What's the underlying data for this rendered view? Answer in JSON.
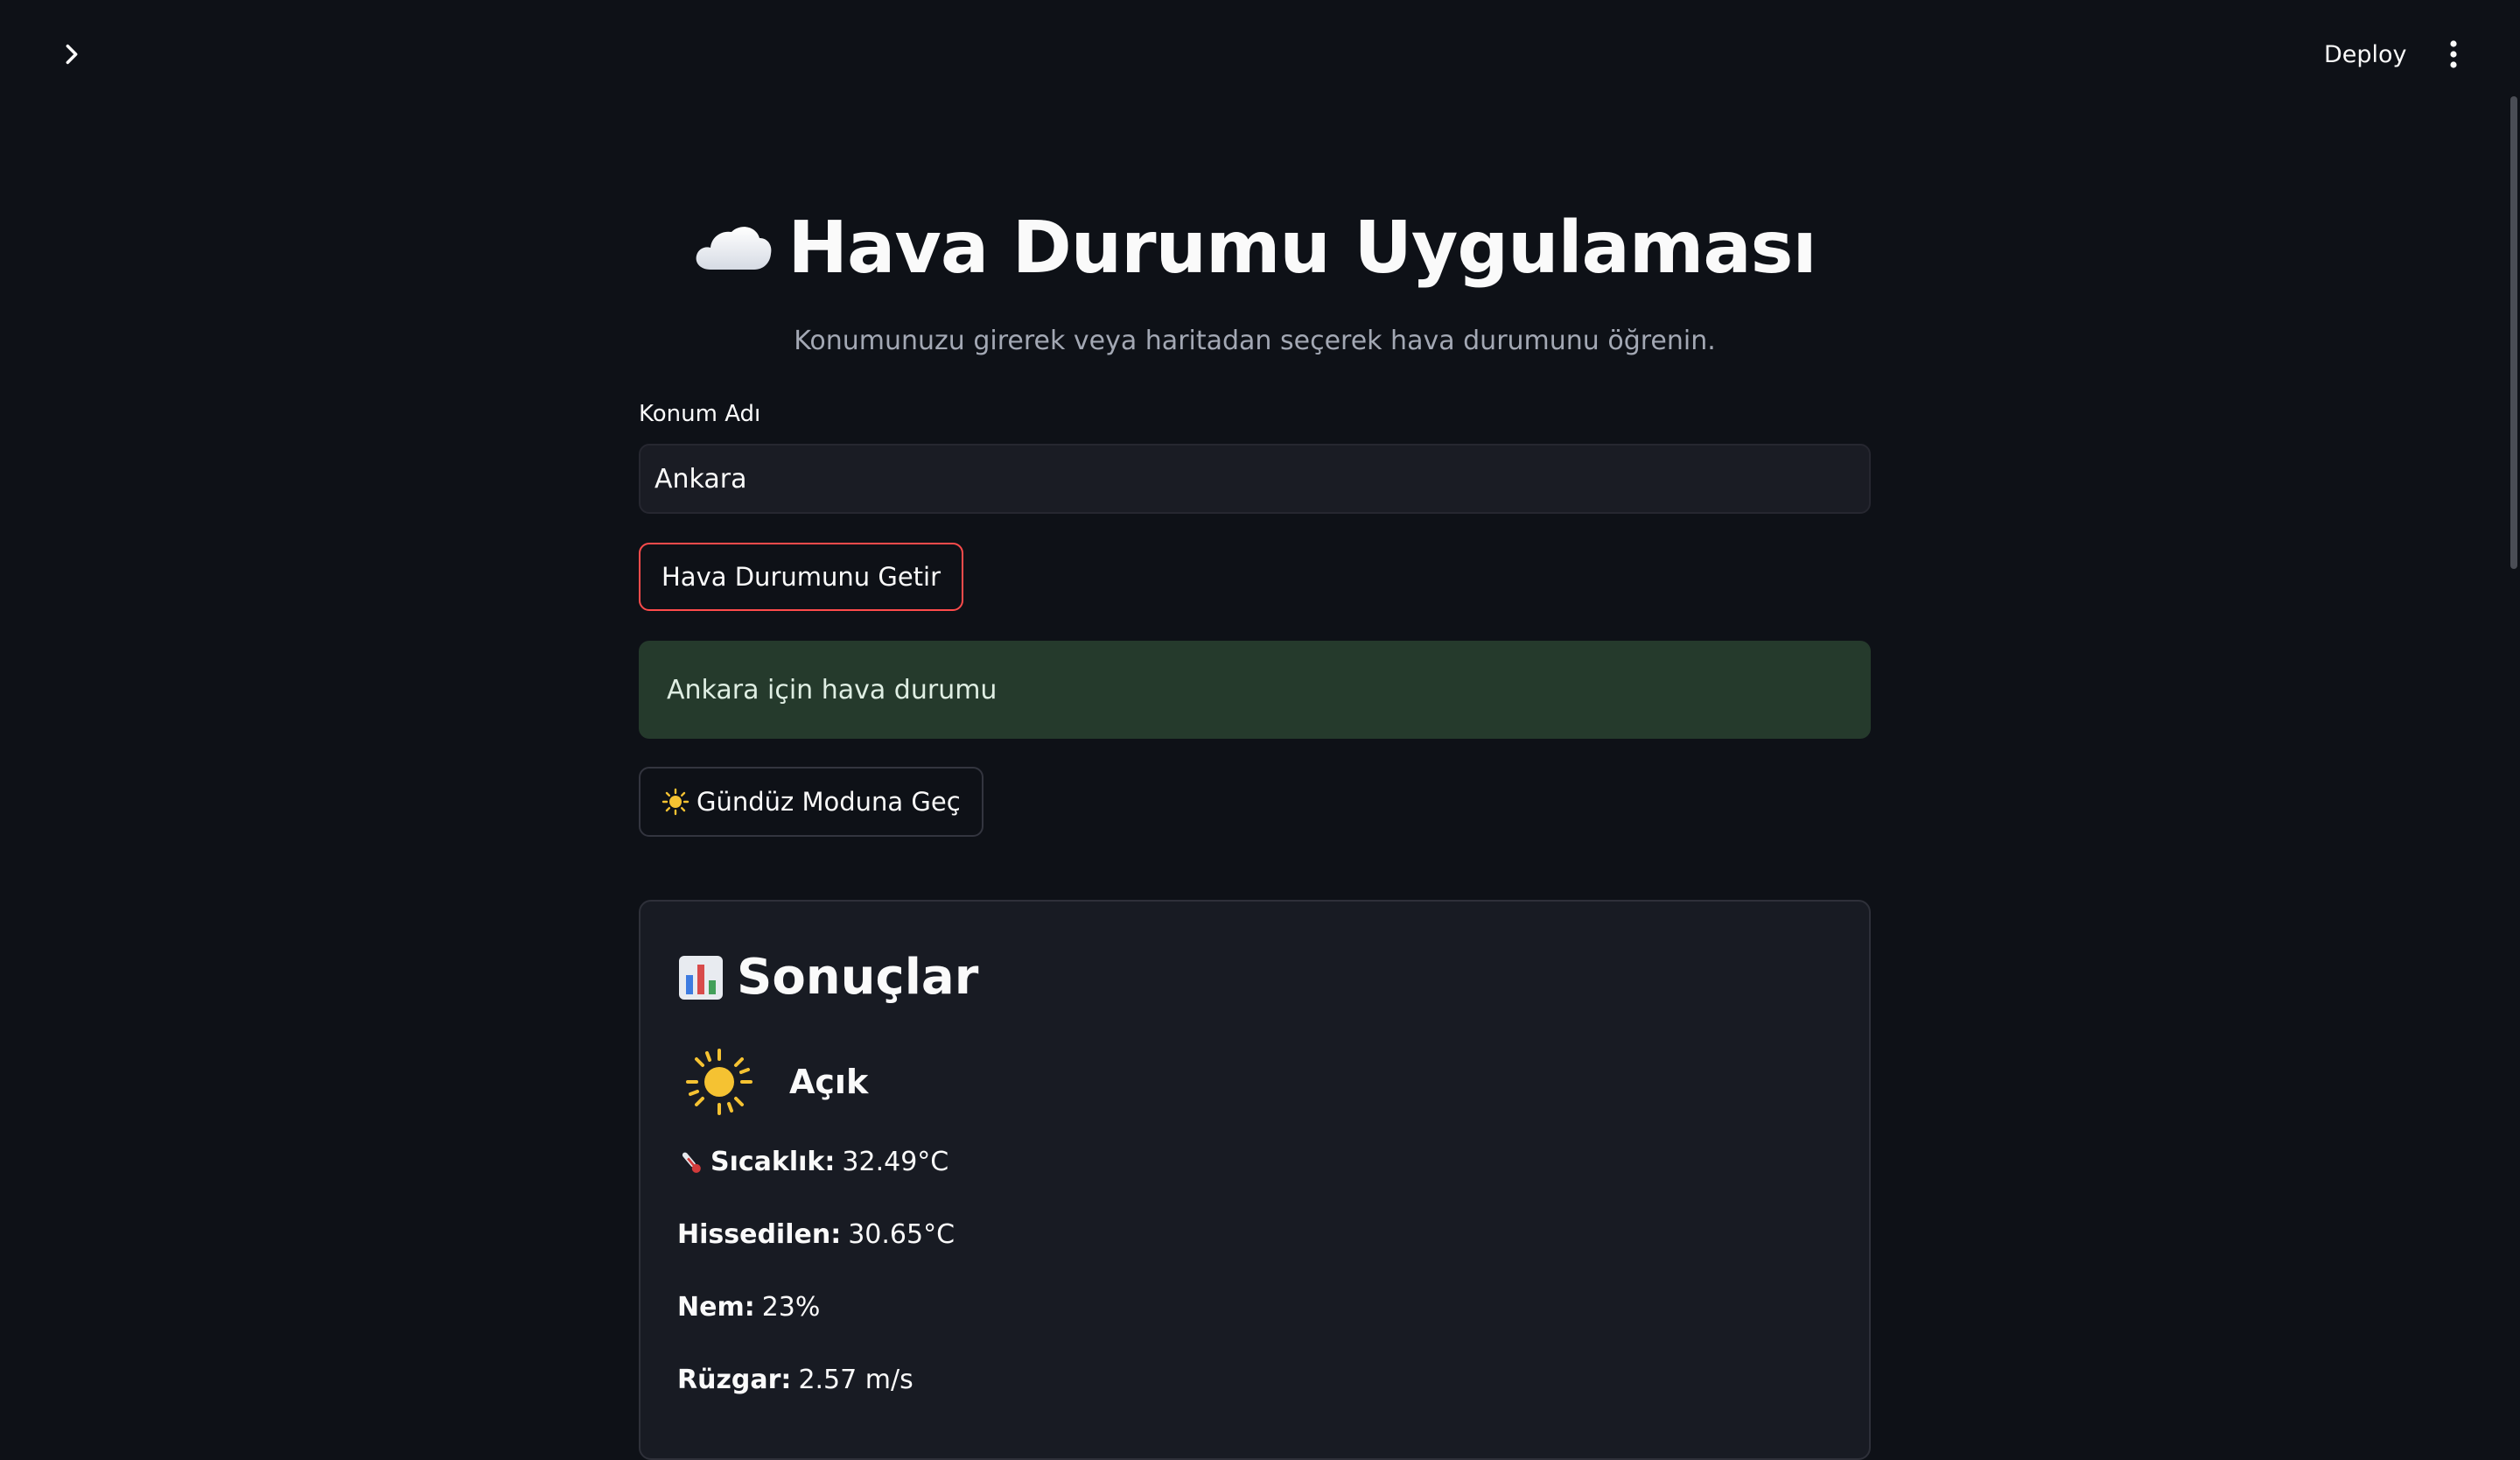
{
  "header": {
    "deploy_label": "Deploy",
    "sidebar_toggle_icon": "chevron-right-icon",
    "menu_icon": "kebab-menu-icon"
  },
  "app": {
    "title_icon": "cloud-icon",
    "title": "Hava Durumu Uygulaması",
    "subtitle": "Konumunuzu girerek veya haritadan seçerek hava durumunu öğrenin."
  },
  "form": {
    "location_label": "Konum Adı",
    "location_value": "Ankara",
    "fetch_button_label": "Hava Durumunu Getir"
  },
  "alert": {
    "text": "Ankara için hava durumu"
  },
  "mode_toggle": {
    "icon": "sun-icon",
    "label": "Gündüz Moduna Geç"
  },
  "results": {
    "heading_icon": "bar-chart-icon",
    "heading": "Sonuçlar",
    "condition_icon": "sun-icon",
    "condition": "Açık",
    "temperature": {
      "icon": "thermometer-icon",
      "label": "Sıcaklık:",
      "value": "32.49°C"
    },
    "feels_like": {
      "label": "Hissedilen:",
      "value": "30.65°C"
    },
    "humidity": {
      "label": "Nem:",
      "value": "23%"
    },
    "wind": {
      "label": "Rüzgar:",
      "value": "2.57 m/s"
    }
  },
  "colors": {
    "background": "#0e1117",
    "accent": "#ff4b4b",
    "success_bg": "#253a2c",
    "card_bg": "#181b23"
  }
}
